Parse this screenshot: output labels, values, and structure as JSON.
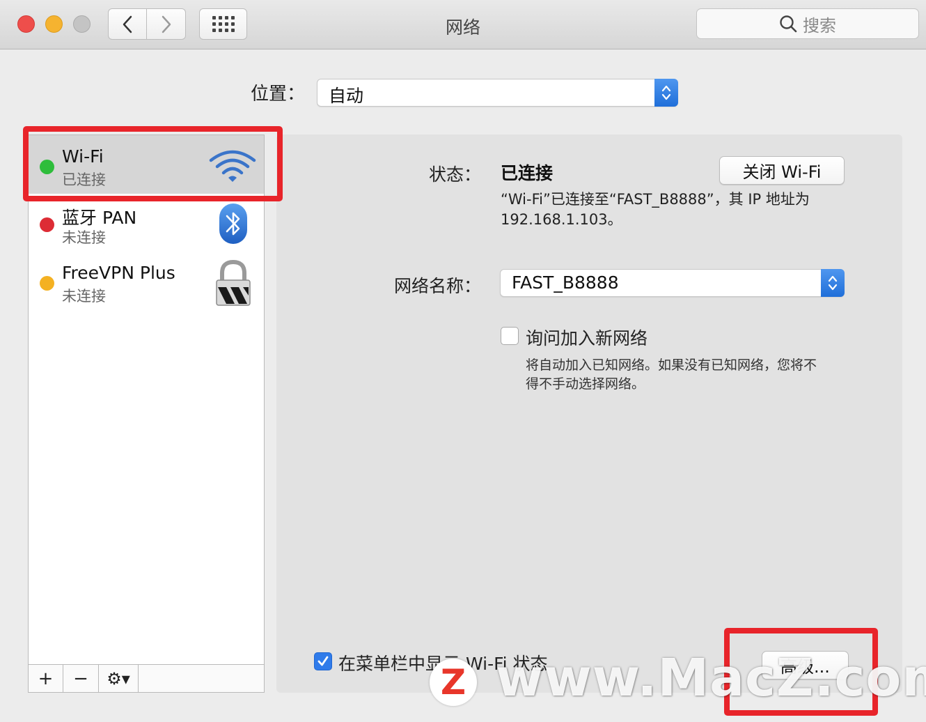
{
  "window": {
    "title": "网络",
    "search_placeholder": "搜索"
  },
  "location": {
    "label": "位置：",
    "value": "自动"
  },
  "services": [
    {
      "name": "Wi-Fi",
      "state": "已连接",
      "status_color": "#2ebd3b",
      "icon": "wifi-icon"
    },
    {
      "name": "蓝牙 PAN",
      "state": "未连接",
      "status_color": "#dd2c35",
      "icon": "bluetooth-icon"
    },
    {
      "name": "FreeVPN Plus",
      "state": "未连接",
      "status_color": "#f4b122",
      "icon": "vpn-lock-icon"
    }
  ],
  "sidebar_actions": {
    "add": "+",
    "remove": "−",
    "gear": "⚙▾"
  },
  "detail": {
    "status_label": "状态：",
    "status_value": "已连接",
    "turn_off_button": "关闭 Wi-Fi",
    "status_desc_line1": "“Wi-Fi”已连接至“FAST_B8888”，其 IP 地址为",
    "status_desc_line2": "192.168.1.103。",
    "network_name_label": "网络名称：",
    "network_name_value": "FAST_B8888",
    "ask_join_label": "询问加入新网络",
    "ask_join_checked": false,
    "ask_join_desc_line1": "将自动加入已知网络。如果没有已知网络，您将不",
    "ask_join_desc_line2": "得不手动选择网络。",
    "show_in_menubar_label": "在菜单栏中显示 Wi-Fi 状态",
    "show_in_menubar_checked": true,
    "advanced_button": "高级..."
  },
  "watermark": {
    "logo_letter": "Z",
    "text": "www.MacZ.com"
  },
  "colors": {
    "highlight": "#e8242a",
    "accent": "#2f7bea"
  }
}
